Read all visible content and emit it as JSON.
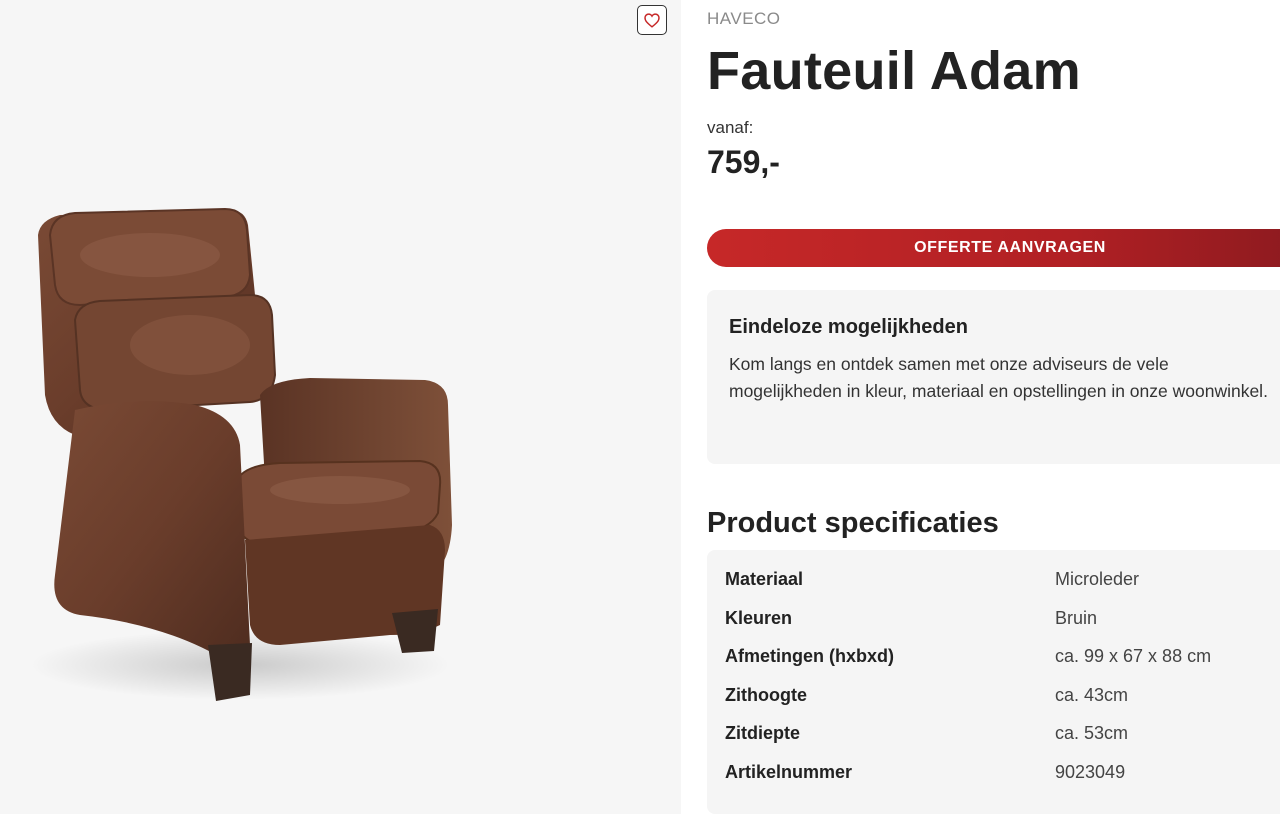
{
  "product": {
    "brand": "HAVECO",
    "title": "Fauteuil Adam",
    "price_label": "vanaf:",
    "price": "759,-"
  },
  "cta": {
    "label": "OFFERTE AANVRAGEN"
  },
  "promo": {
    "title": "Eindeloze mogelijkheden",
    "text": "Kom langs en ontdek samen met onze adviseurs de vele mogelijkheden in kleur, materiaal en opstellingen in onze woonwinkel."
  },
  "specs": {
    "title": "Product specificaties",
    "rows": [
      {
        "key": "Materiaal",
        "value": "Microleder"
      },
      {
        "key": "Kleuren",
        "value": "Bruin"
      },
      {
        "key": "Afmetingen (hxbxd)",
        "value": "ca. 99 x 67 x 88 cm"
      },
      {
        "key": "Zithoogte",
        "value": "ca. 43cm"
      },
      {
        "key": "Zitdiepte",
        "value": "ca. 53cm"
      },
      {
        "key": "Artikelnummer",
        "value": "9023049"
      }
    ]
  },
  "icons": {
    "favorite": "heart-icon"
  },
  "colors": {
    "accent": "#c62828",
    "panel": "#f5f5f5",
    "image_bg": "#f6f6f6"
  }
}
